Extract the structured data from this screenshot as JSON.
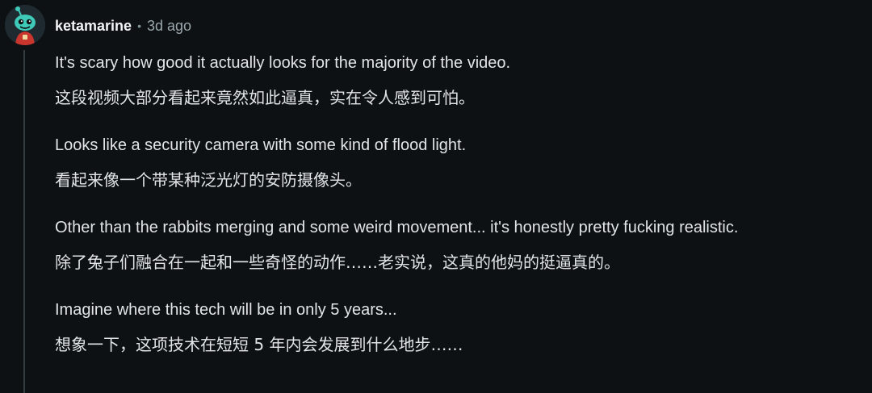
{
  "comment": {
    "author": "ketamarine",
    "separator": "•",
    "time": "3d ago",
    "avatar_icon": "snoo-avatar-icon",
    "paragraphs": [
      {
        "en": "It's scary how good it actually looks for the majority of the video.",
        "zh": "这段视频大部分看起来竟然如此逼真，实在令人感到可怕。"
      },
      {
        "en": "Looks like a security camera with some kind of flood light.",
        "zh": "看起来像一个带某种泛光灯的安防摄像头。"
      },
      {
        "en": "Other than the rabbits merging and some weird movement... it's honestly pretty fucking realistic.",
        "zh": "除了兔子们融合在一起和一些奇怪的动作……老实说，这真的他妈的挺逼真的。"
      },
      {
        "en": "Imagine where this tech will be in only 5 years...",
        "zh": "想象一下，这项技术在短短 5 年内会发展到什么地步……"
      }
    ]
  },
  "colors": {
    "background": "#0e1113",
    "text": "#e2e5e7",
    "meta": "#9aa7ad",
    "thread_line": "#333d42",
    "avatar_accent": "#3fc9b8"
  }
}
